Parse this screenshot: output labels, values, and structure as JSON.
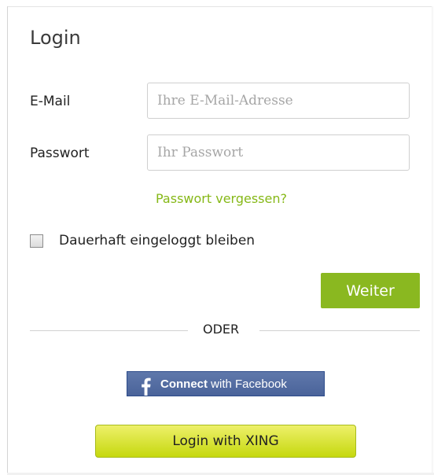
{
  "login": {
    "title": "Login",
    "email_label": "E-Mail",
    "email_placeholder": "Ihre E-Mail-Adresse",
    "email_value": "",
    "password_label": "Passwort",
    "password_placeholder": "Ihr Passwort",
    "password_value": "",
    "forgot_password": "Passwort vergessen?",
    "remember_me": "Dauerhaft eingeloggt bleiben",
    "remember_checked": false,
    "submit": "Weiter",
    "divider": "ODER",
    "facebook": {
      "connect": "Connect",
      "with": " with Facebook",
      "icon": "facebook-f-icon"
    },
    "xing": "Login with XING"
  },
  "colors": {
    "accent_green": "#86b817",
    "button_green": "#8ab820",
    "facebook_blue": "#4a639a",
    "xing_yellow": "#c6d80e"
  }
}
